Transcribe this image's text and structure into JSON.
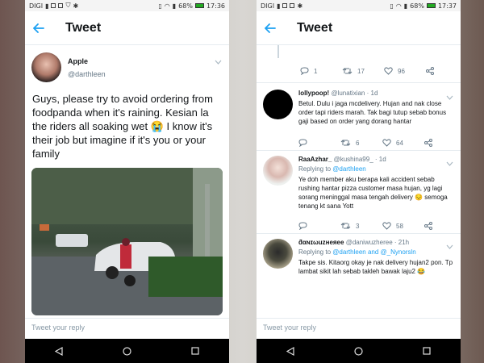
{
  "statusbar_left": {
    "carrier": "DIGI",
    "battery": "68%",
    "time": "17:36"
  },
  "statusbar_right": {
    "carrier": "DIGI",
    "battery": "68%",
    "time": "17:37"
  },
  "appbar": {
    "title": "Tweet"
  },
  "tweet": {
    "author_name": "Apple",
    "author_handle": "@darthleen",
    "text": "Guys, please try to avoid ordering from foodpanda when it's raining. Kesian la the riders all soaking wet 😭 I know it's their job but imagine if it's you or your family"
  },
  "reply_placeholder": "Tweet your reply",
  "parent_actions": {
    "replies": "1",
    "retweets": "17",
    "likes": "96"
  },
  "replies": [
    {
      "name": "lollypoop!",
      "handle": "@lunatixian",
      "time": "· 1d",
      "replying_to": "",
      "text": "Betul. Dulu i jaga mcdelivery. Hujan and nak close order tapi riders marah. Tak bagi tutup sebab bonus gaji based on order yang dorang hantar",
      "replies": "",
      "retweets": "6",
      "likes": "64"
    },
    {
      "name": "RaaAzhar_",
      "handle": "@kushina99_",
      "time": "· 1d",
      "replying_prefix": "Replying to ",
      "replying_to": "@darthleen",
      "text": "Ye doh member aku berapa kali accident sebab rushing hantar pizza customer masa hujan, yg lagi sorang meninggal masa tengah delivery 😔 semoga tenang kt sana Yott",
      "replies": "",
      "retweets": "3",
      "likes": "58"
    },
    {
      "name": "ƌαɴɪωuzнeяee",
      "handle": "@daniwuzheree",
      "time": "· 21h",
      "replying_prefix": "Replying to ",
      "replying_to": "@darthleen and @_Nynorsln",
      "text": "Takpe sis. Kitaorg okay je nak delivery hujan2 pon. Tp lambat sikit lah sebab takleh bawak laju2 😂"
    }
  ],
  "colors": {
    "accent": "#1da1f2",
    "text": "#14171a",
    "muted": "#657786"
  }
}
